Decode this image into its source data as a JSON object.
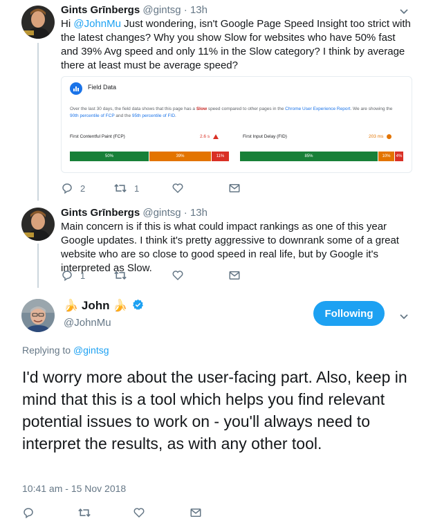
{
  "reply1": {
    "author_name": "Gints Grīnbergs",
    "handle": "@gintsg",
    "time": "13h",
    "text_pre": "Hi ",
    "mention": "@JohnMu",
    "text_post": " Just wondering, isn't Google Page Speed Insight too strict with the latest changes? Why you show Slow for websites who have 50% fast and 39% Avg speed and only 11% in the Slow category? I think by average there at least must be average speed?",
    "actions": {
      "reply_count": "2",
      "retweet_count": "1",
      "like_count": ""
    },
    "card": {
      "title": "Field Data",
      "desc_1": "Over the last 30 days, the field data shows that this page has a ",
      "desc_slow": "Slow",
      "desc_2": " speed compared to other pages in the ",
      "desc_link1": "Chrome User Experience Report",
      "desc_3": ". We are showing the ",
      "desc_link2": "90th percentile of FCP",
      "desc_4": " and the ",
      "desc_link3": "95th percentile of FID",
      "desc_5": ".",
      "fcp": {
        "label": "First Contentful Paint (FCP)",
        "value": "2.6 s",
        "status_color": "#d93025",
        "segments": [
          {
            "label": "50%",
            "fraction": 0.5,
            "color": "#188038"
          },
          {
            "label": "39%",
            "fraction": 0.39,
            "color": "#e37400"
          },
          {
            "label": "11%",
            "fraction": 0.11,
            "color": "#d93025"
          }
        ]
      },
      "fid": {
        "label": "First Input Delay (FID)",
        "value": "203 ms",
        "status_color": "#e37400",
        "segments": [
          {
            "label": "85%",
            "fraction": 0.85,
            "color": "#188038"
          },
          {
            "label": "10%",
            "fraction": 0.1,
            "color": "#e37400"
          },
          {
            "label": "4%",
            "fraction": 0.05,
            "color": "#d93025"
          }
        ]
      }
    }
  },
  "reply2": {
    "author_name": "Gints Grīnbergs",
    "handle": "@gintsg",
    "time": "13h",
    "text": "Main concern is if this is what could impact rankings as one of this year Google updates. I think it's pretty aggressive to downrank some of a great website who are so close to good speed in real life, but by Google it's interpreted as Slow.",
    "actions": {
      "reply_count": "1",
      "retweet_count": "",
      "like_count": ""
    }
  },
  "main": {
    "emoji_left": "🍌",
    "display_name": "John",
    "emoji_right": "🍌",
    "handle": "@JohnMu",
    "follow_label": "Following",
    "replying_prefix": "Replying to ",
    "replying_to": "@gintsg",
    "text": "I'd worry more about the user-facing part. Also, keep in mind that this is a tool which helps you find relevant potential issues to work on - you'll always need to interpret the results, as with any other tool.",
    "timestamp": "10:41 am - 15 Nov 2018"
  },
  "colors": {
    "accent": "#1da1f2",
    "secondary_text": "#657786",
    "thread_line": "#ccd6dd"
  }
}
